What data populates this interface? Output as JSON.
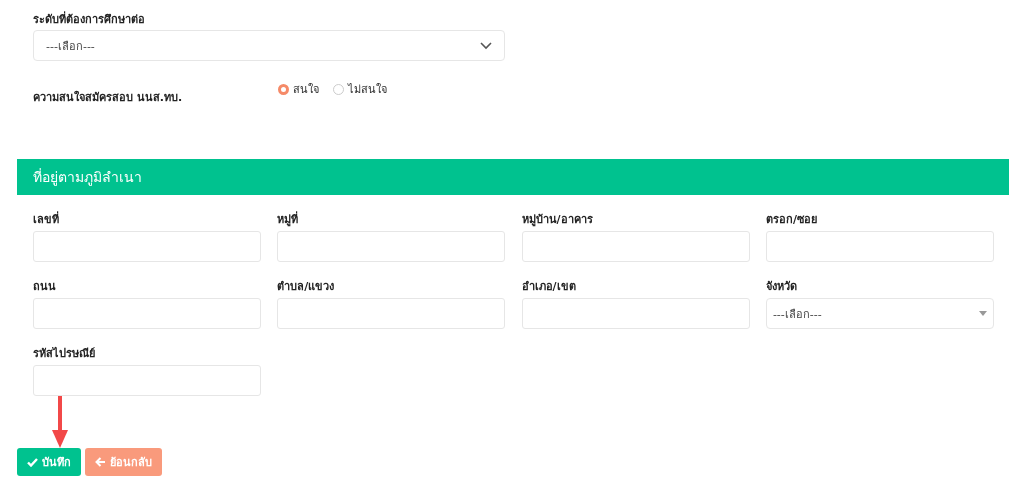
{
  "education_level": {
    "label": "ระดับที่ต้องการศึกษาต่อ",
    "value": "---เลือก---"
  },
  "interest": {
    "label": "ความสนใจสมัครสอบ นนส.ทบ.",
    "options": [
      {
        "label": "สนใจ",
        "selected": true
      },
      {
        "label": "ไม่สนใจ",
        "selected": false
      }
    ]
  },
  "address": {
    "title": "ที่อยู่ตามภูมิลำเนา",
    "fields": [
      {
        "label": "เลขที่",
        "kind": "text"
      },
      {
        "label": "หมู่ที่",
        "kind": "text"
      },
      {
        "label": "หมู่บ้าน/อาคาร",
        "kind": "text"
      },
      {
        "label": "ตรอก/ซอย",
        "kind": "text"
      },
      {
        "label": "ถนน",
        "kind": "text"
      },
      {
        "label": "ตำบล/แขวง",
        "kind": "text"
      },
      {
        "label": "อำเภอ/เขต",
        "kind": "text"
      },
      {
        "label": "จังหวัด",
        "kind": "select",
        "value": "---เลือก---"
      },
      {
        "label": "รหัสไปรษณีย์",
        "kind": "text"
      }
    ]
  },
  "buttons": [
    {
      "label": "บันทึก",
      "kind": "save"
    },
    {
      "label": "ย้อนกลับ",
      "kind": "back"
    }
  ]
}
